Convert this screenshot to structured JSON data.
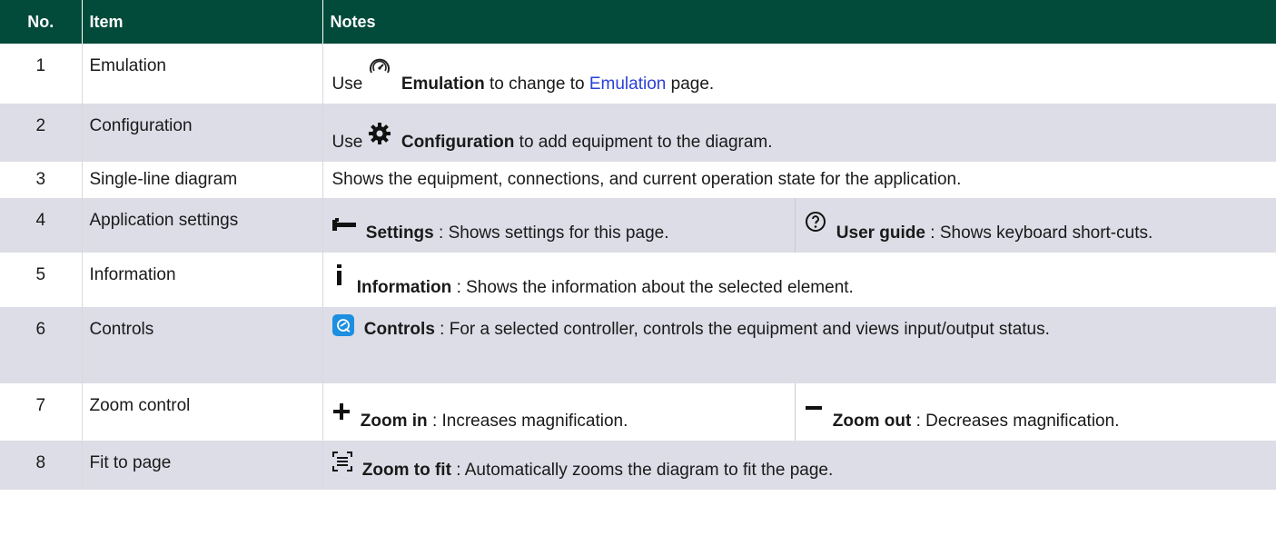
{
  "header": {
    "no": "No.",
    "item": "Item",
    "notes": "Notes"
  },
  "rows": [
    {
      "no": "1",
      "item": "Emulation",
      "notes": {
        "pre": "Use",
        "bold": "Emulation",
        "mid": "to change to",
        "link": "Emulation",
        "post": "page.",
        "icon": "speedometer-icon"
      }
    },
    {
      "no": "2",
      "item": "Configuration",
      "notes": {
        "pre": "Use",
        "bold": "Configuration",
        "post": "to add equipment to the diagram.",
        "icon": "gear-icon"
      }
    },
    {
      "no": "3",
      "item": "Single-line diagram",
      "notes": {
        "text": "Shows the equipment, connections, and current operation state for the application."
      }
    },
    {
      "no": "4",
      "item": "Application settings",
      "notes": {
        "left": {
          "bold": "Settings",
          "post": ": Shows settings for this page.",
          "icon": "wrench-icon"
        },
        "right": {
          "bold": "User guide",
          "post": ": Shows keyboard short-cuts.",
          "icon": "help-circle-icon"
        }
      }
    },
    {
      "no": "5",
      "item": "Information",
      "notes": {
        "bold": "Information",
        "post": ": Shows the information about the selected element.",
        "icon": "info-icon"
      }
    },
    {
      "no": "6",
      "item": "Controls",
      "notes": {
        "bold": "Controls",
        "post": ": For a selected controller, controls the equipment and views input/output status.",
        "icon": "controls-icon"
      }
    },
    {
      "no": "7",
      "item": "Zoom control",
      "notes": {
        "left": {
          "bold": "Zoom in",
          "post": ": Increases magnification.",
          "icon": "plus-icon"
        },
        "right": {
          "bold": "Zoom out",
          "post": ": Decreases magnification.",
          "icon": "minus-icon"
        }
      }
    },
    {
      "no": "8",
      "item": "Fit to page",
      "notes": {
        "bold": "Zoom to fit",
        "post": ": Automatically zooms the diagram to fit the page.",
        "icon": "zoom-to-fit-icon"
      }
    }
  ],
  "colors": {
    "header_bg": "#024a3a",
    "row_alt_bg": "#dcdde6",
    "link": "#2b3fd6",
    "controls_badge": "#1c8fe0"
  }
}
